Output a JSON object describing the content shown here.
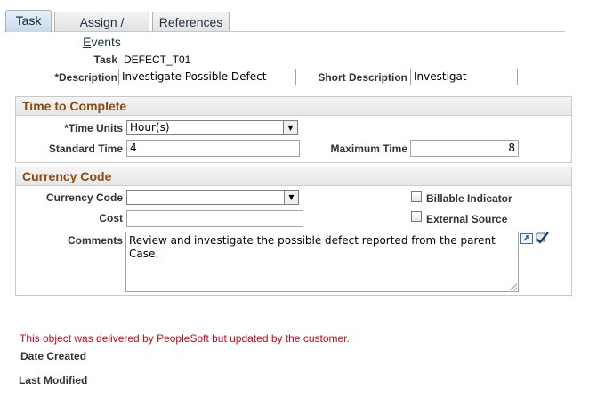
{
  "tabs": [
    {
      "label": "Task",
      "active": true
    },
    {
      "label_prefix": "Assign / ",
      "label_ul": "E",
      "label_suffix": "vents",
      "active": false
    },
    {
      "label_prefix": "",
      "label_ul": "R",
      "label_suffix": "eferences",
      "active": false
    }
  ],
  "task": {
    "task_label": "Task",
    "task_value": "DEFECT_T01",
    "description_label": "*Description",
    "description_value": "Investigate Possible Defect",
    "short_description_label": "Short Description",
    "short_description_value": "Investigat"
  },
  "time_to_complete": {
    "title": "Time to Complete",
    "time_units_label": "*Time Units",
    "time_units_value": "Hour(s)",
    "standard_time_label": "Standard Time",
    "standard_time_value": "4",
    "maximum_time_label": "Maximum Time",
    "maximum_time_value": "8"
  },
  "currency": {
    "title": "Currency Code",
    "currency_code_label": "Currency Code",
    "currency_code_value": "",
    "billable_label": "Billable Indicator",
    "cost_label": "Cost",
    "cost_value": "",
    "external_label": "External Source",
    "comments_label": "Comments",
    "comments_value": "Review and investigate the possible defect reported from the parent Case."
  },
  "footer": {
    "message": "This object was delivered by PeopleSoft but updated by the customer.",
    "date_created_label": "Date Created",
    "last_modified_label": "Last Modified"
  },
  "colors": {
    "group_title": "#8a4a10",
    "message": "#d0021b"
  },
  "icons": [
    "expand-textarea-icon",
    "spell-check-icon"
  ]
}
